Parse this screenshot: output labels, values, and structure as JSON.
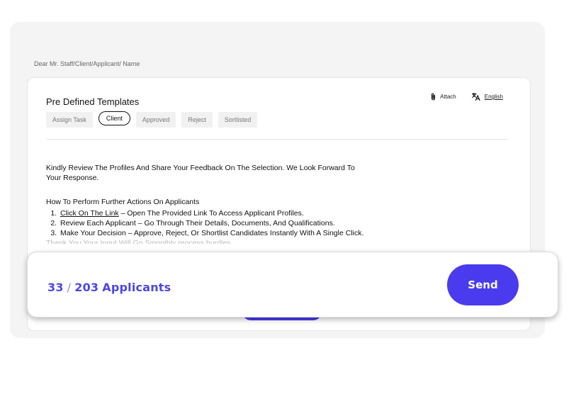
{
  "salutation": "Dear Mr. Staff/Client/Applicant/ Name",
  "templates": {
    "title": "Pre Defined Templates",
    "chips": [
      {
        "label": "Assign Task"
      },
      {
        "label": "Client",
        "active": true
      },
      {
        "label": "Approved"
      },
      {
        "label": "Reject"
      },
      {
        "label": "Sortlisted"
      }
    ],
    "attach_label": "Attach",
    "language_label": "English",
    "icons": {
      "attach": "paperclip-icon",
      "language": "translate-icon"
    }
  },
  "message": {
    "intro": "Kindly Review The Profiles And Share Your Feedback On The Selection. We Look Forward To Your Response.",
    "steps_heading": "How To Perform Further Actions On Applicants",
    "step1_link": "Click On The Link",
    "step1_rest": " – Open The Provided Link To Access Applicant Profiles.",
    "step2": "Review Each Applicant – Go Through Their Details, Documents, And Qualifications.",
    "step3": "Make Your Decision – Approve, Reject, Or Shortlist Candidates Instantly With A Single Click.",
    "cutoff_line": "Thank You Your Input Will Go Smoothly process hurdles."
  },
  "footer": {
    "selected": "33",
    "separator": "/",
    "total": "203",
    "unit": "Applicants",
    "send_label": "Send"
  },
  "colors": {
    "accent": "#4a3bef",
    "count_text": "#4f46e5",
    "panel_bg": "#f4f4f4"
  }
}
